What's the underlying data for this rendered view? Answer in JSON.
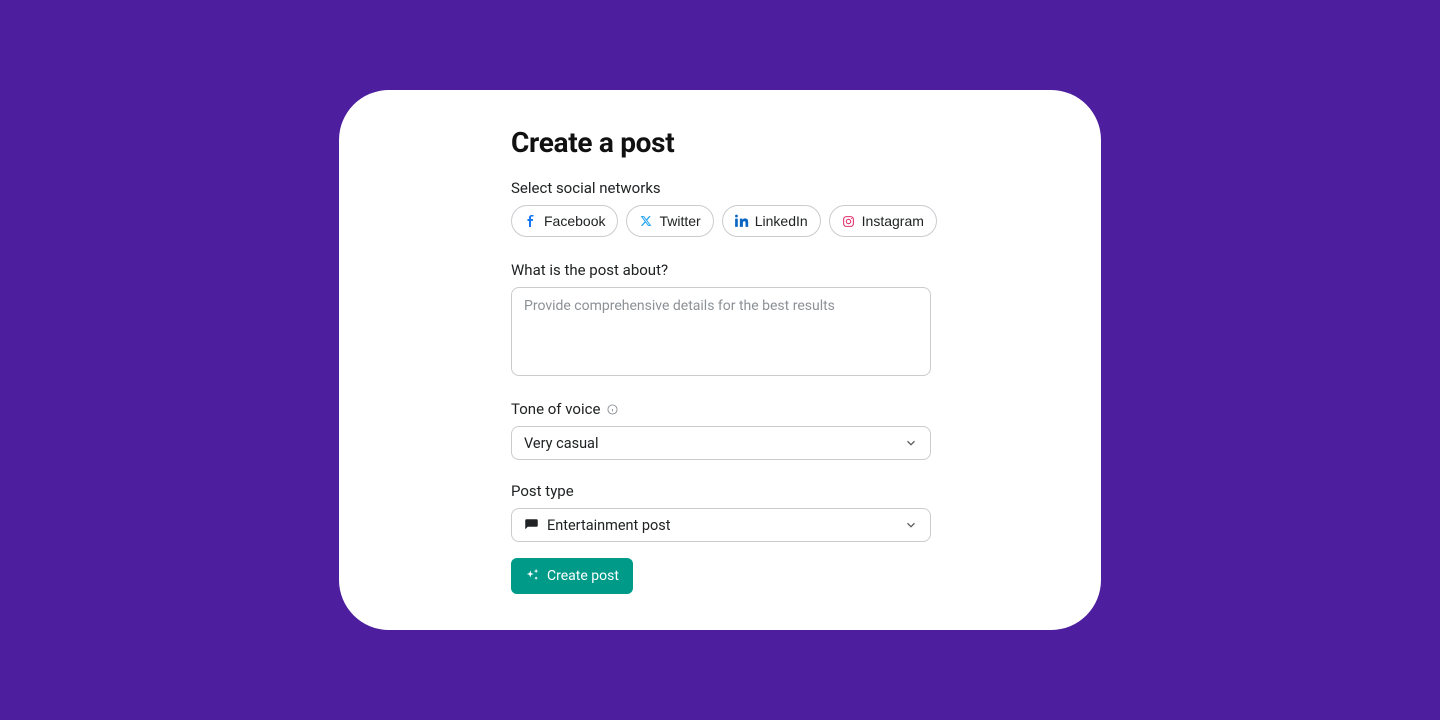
{
  "title": "Create a post",
  "networks": {
    "label": "Select social networks",
    "items": [
      {
        "label": "Facebook",
        "icon": "facebook",
        "color": "#1877f2"
      },
      {
        "label": "Twitter",
        "icon": "twitter",
        "color": "#1da1f2"
      },
      {
        "label": "LinkedIn",
        "icon": "linkedin",
        "color": "#0a66c2"
      },
      {
        "label": "Instagram",
        "icon": "instagram",
        "color": "#e1306c"
      }
    ]
  },
  "about": {
    "label": "What is the post about?",
    "placeholder": "Provide comprehensive details for the best results",
    "value": ""
  },
  "tone": {
    "label": "Tone of voice",
    "selected": "Very casual"
  },
  "postType": {
    "label": "Post type",
    "selected": "Entertainment post"
  },
  "submit": {
    "label": "Create post"
  }
}
